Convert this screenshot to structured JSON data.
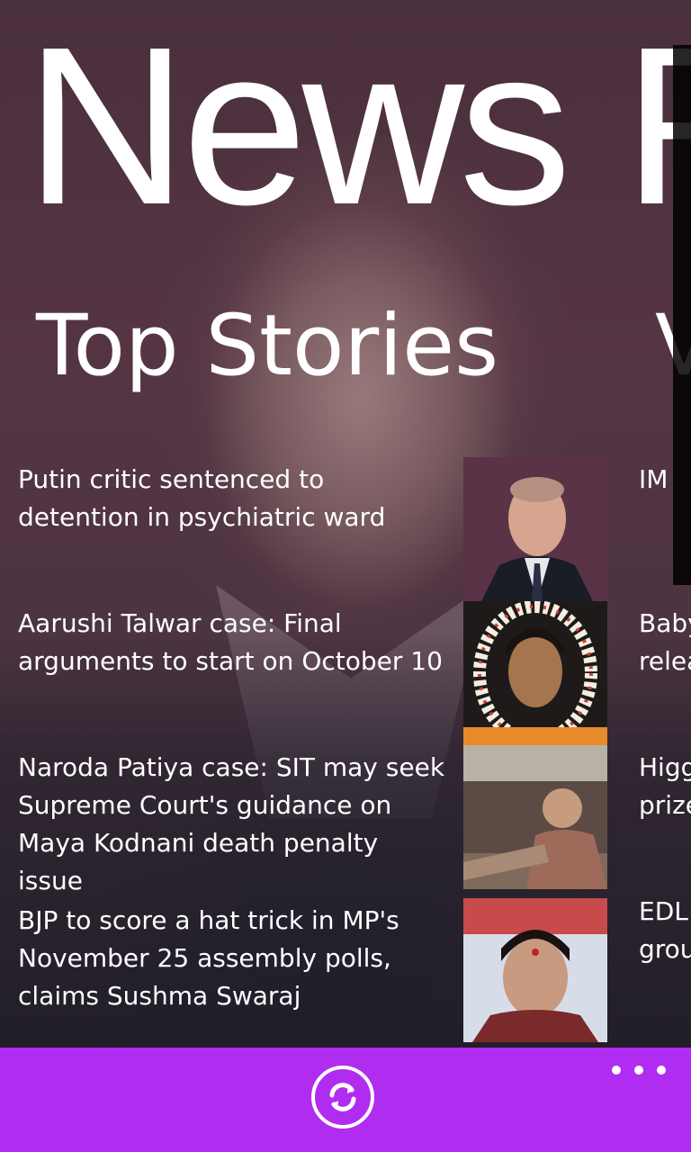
{
  "app": {
    "title": "News R"
  },
  "sections": {
    "current": "Top Stories",
    "next_peek": "V"
  },
  "stories": [
    {
      "title": "Putin critic sentenced to detention in psychiatric ward",
      "thumb_icon": "putin-photo"
    },
    {
      "title": "Aarushi Talwar case: Final arguments to start on October 10",
      "thumb_icon": "aarushi-photo"
    },
    {
      "title": "Naroda Patiya case: SIT may seek Supreme Court's guidance on Maya Kodnani death penalty issue",
      "thumb_icon": "kodnani-photo"
    },
    {
      "title": "BJP to score a hat trick in MP's November 25 assembly polls, claims Sushma Swaraj",
      "thumb_icon": "swaraj-photo"
    }
  ],
  "next_column_peek": [
    {
      "text": "IM"
    },
    {
      "line1": "Baby",
      "line2": "relea"
    },
    {
      "line1": "Higg",
      "line2": "prize"
    },
    {
      "line1": "EDL",
      "line2": "grou"
    }
  ],
  "app_bar": {
    "refresh_icon": "refresh-icon",
    "more_icon": "more-icon",
    "color": "#b02cf0"
  }
}
